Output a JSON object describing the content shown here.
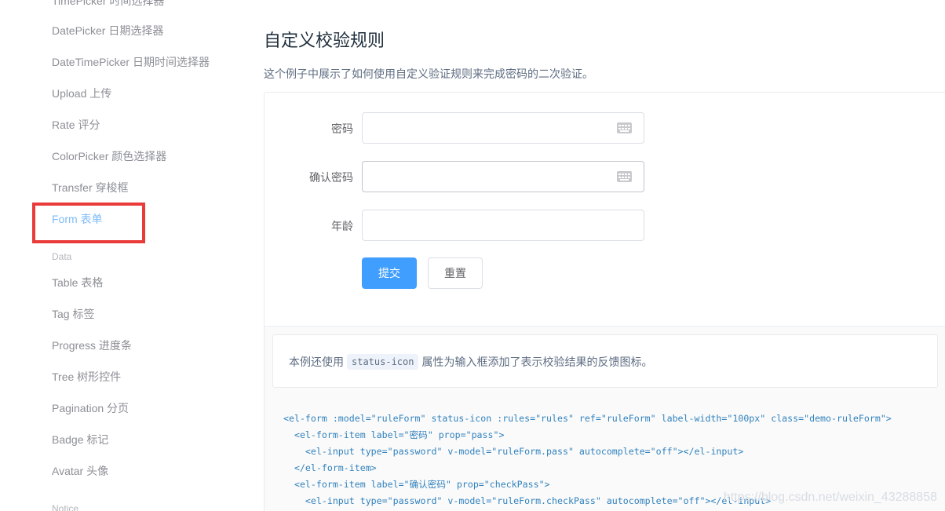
{
  "sidebar": {
    "items": [
      {
        "label": "TimePicker 时间选择器"
      },
      {
        "label": "DatePicker 日期选择器"
      },
      {
        "label": "DateTimePicker 日期时间选择器"
      },
      {
        "label": "Upload 上传"
      },
      {
        "label": "Rate 评分"
      },
      {
        "label": "ColorPicker 颜色选择器"
      },
      {
        "label": "Transfer 穿梭框"
      },
      {
        "label": "Form 表单"
      },
      {
        "label": "Table 表格"
      },
      {
        "label": "Tag 标签"
      },
      {
        "label": "Progress 进度条"
      },
      {
        "label": "Tree 树形控件"
      },
      {
        "label": "Pagination 分页"
      },
      {
        "label": "Badge 标记"
      },
      {
        "label": "Avatar 头像"
      }
    ],
    "groups": {
      "data": "Data",
      "notice": "Notice"
    }
  },
  "page": {
    "title": "自定义校验规则",
    "description": "这个例子中展示了如何使用自定义验证规则来完成密码的二次验证。"
  },
  "form": {
    "password_label": "密码",
    "confirm_label": "确认密码",
    "age_label": "年龄",
    "submit": "提交",
    "reset": "重置"
  },
  "meta": {
    "desc_before": "本例还使用",
    "desc_code": "status-icon",
    "desc_after": "属性为输入框添加了表示校验结果的反馈图标。"
  },
  "code_lines": [
    "<el-form :model=\"ruleForm\" status-icon :rules=\"rules\" ref=\"ruleForm\" label-width=\"100px\" class=\"demo-ruleForm\">",
    "  <el-form-item label=\"密码\" prop=\"pass\">",
    "    <el-input type=\"password\" v-model=\"ruleForm.pass\" autocomplete=\"off\"></el-input>",
    "  </el-form-item>",
    "  <el-form-item label=\"确认密码\" prop=\"checkPass\">",
    "    <el-input type=\"password\" v-model=\"ruleForm.checkPass\" autocomplete=\"off\"></el-input>"
  ],
  "watermark": "https://blog.csdn.net/weixin_43288858",
  "colors": {
    "primary": "#409eff",
    "highlight": "#ea3b3b",
    "active_nav": "#7dbcf7"
  }
}
